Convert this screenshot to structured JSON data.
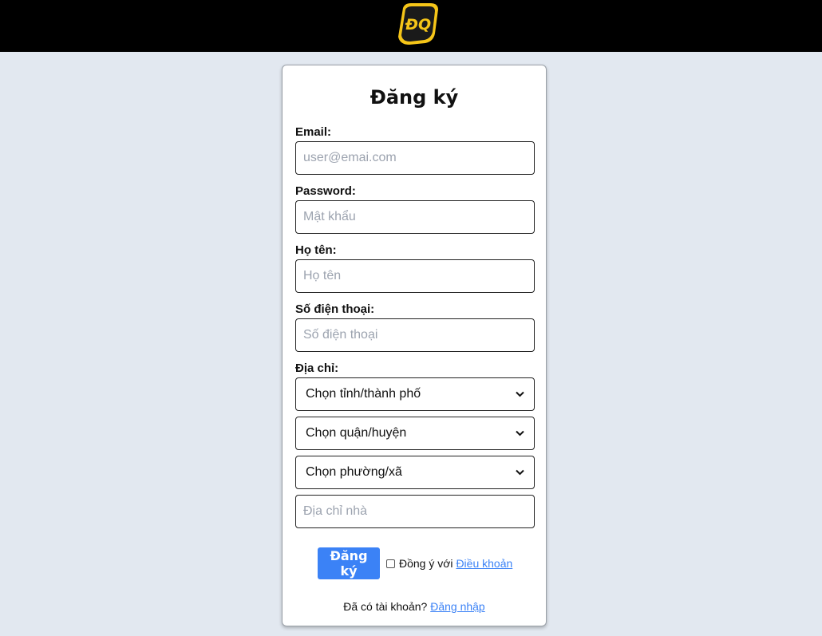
{
  "header": {
    "logo_text": "ĐQ",
    "logo_colors": {
      "outer": "#f5c518",
      "inner": "#1a1a1a",
      "text": "#f5c518"
    }
  },
  "form": {
    "title": "Đăng ký",
    "email": {
      "label": "Email:",
      "placeholder": "user@emai.com"
    },
    "password": {
      "label": "Password:",
      "placeholder": "Mật khẩu"
    },
    "fullname": {
      "label": "Họ tên:",
      "placeholder": "Họ tên"
    },
    "phone": {
      "label": "Số điện thoại:",
      "placeholder": "Số điện thoại"
    },
    "address": {
      "label": "Địa chỉ:",
      "province": "Chọn tỉnh/thành phố",
      "district": "Chọn quận/huyện",
      "ward": "Chọn phường/xã",
      "house_placeholder": "Địa chỉ nhà"
    },
    "submit_label": "Đăng ký",
    "agree_text": "Đồng ý với",
    "terms_link": "Điều khoản",
    "have_account": "Đã có tài khoản?",
    "login_link": "Đăng nhập"
  },
  "colors": {
    "page_bg": "#e2e8f0",
    "topbar_bg": "#000000",
    "button_bg": "#3b82f6",
    "link": "#3b82f6"
  }
}
